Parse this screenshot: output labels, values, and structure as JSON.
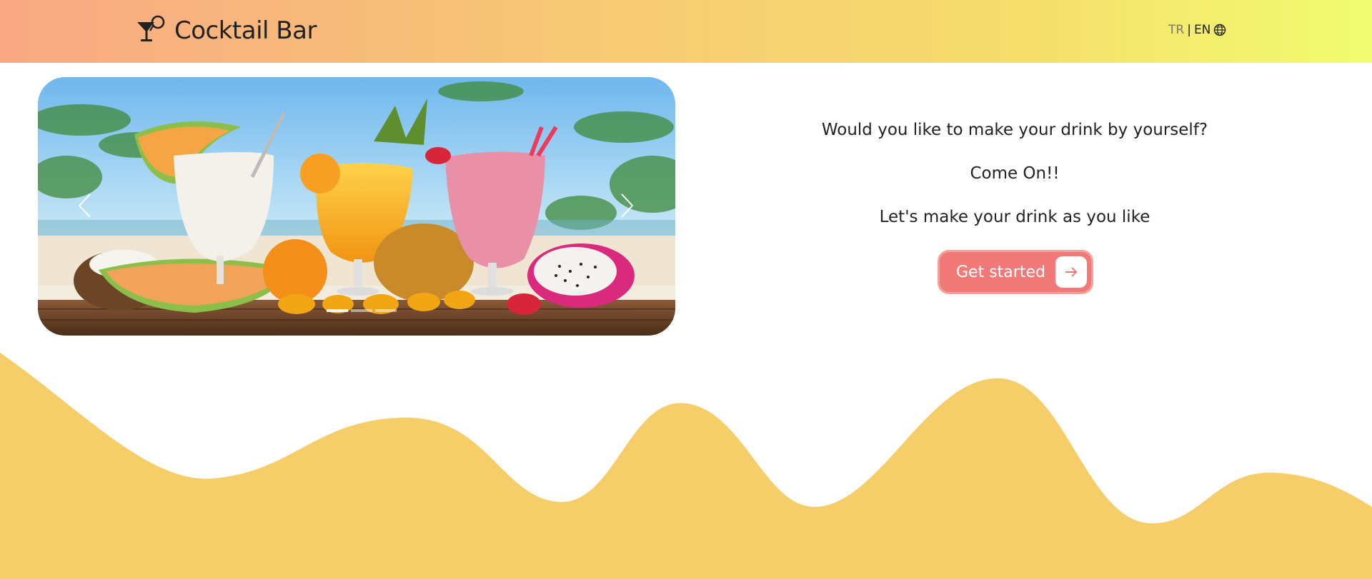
{
  "navbar": {
    "brand_icon": "cocktail-glass-icon",
    "brand_name": "Cocktail Bar",
    "language": {
      "tr": "TR",
      "separator": "|",
      "en": "EN",
      "icon": "globe-icon"
    },
    "gradient": [
      "#f8a883",
      "#f7c775",
      "#f6de6c",
      "#f1fd70"
    ]
  },
  "carousel": {
    "image_alt": "tropical cocktails with fruits on a beach",
    "prev_icon": "chevron-left-icon",
    "next_icon": "chevron-right-icon",
    "slide_count": 3,
    "active_slide": 0
  },
  "hero": {
    "line1": "Would you like to make your drink by yourself?",
    "line2": "Come On!!",
    "line3": "Let's make your drink as you like",
    "cta_label": "Get started",
    "cta_icon": "arrow-right-icon"
  },
  "colors": {
    "cta": "#f17a78",
    "wave": "#f5cd69"
  }
}
